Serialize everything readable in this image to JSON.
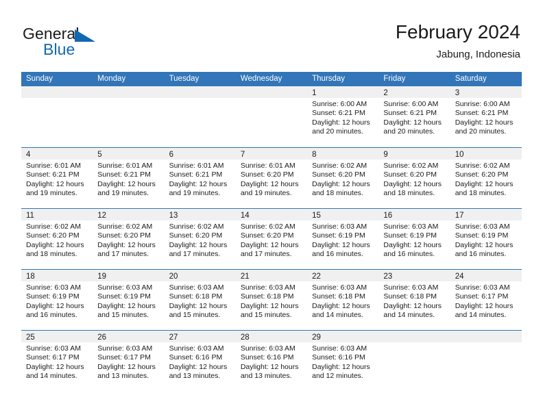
{
  "brand": {
    "name_top": "General",
    "name_bottom": "Blue",
    "accent_color": "#1268b3",
    "triangle_icon": "brand-triangle-icon"
  },
  "header": {
    "title": "February 2024",
    "subtitle": "Jabung, Indonesia"
  },
  "colors": {
    "header_blue": "#3275b8",
    "day_band_gray": "#f0f0f0",
    "text": "#1a1a1a"
  },
  "weekdays": [
    "Sunday",
    "Monday",
    "Tuesday",
    "Wednesday",
    "Thursday",
    "Friday",
    "Saturday"
  ],
  "weeks": [
    [
      {
        "day": "",
        "sunrise": "",
        "sunset": "",
        "daylight": ""
      },
      {
        "day": "",
        "sunrise": "",
        "sunset": "",
        "daylight": ""
      },
      {
        "day": "",
        "sunrise": "",
        "sunset": "",
        "daylight": ""
      },
      {
        "day": "",
        "sunrise": "",
        "sunset": "",
        "daylight": ""
      },
      {
        "day": "1",
        "sunrise": "Sunrise: 6:00 AM",
        "sunset": "Sunset: 6:21 PM",
        "daylight": "Daylight: 12 hours and 20 minutes."
      },
      {
        "day": "2",
        "sunrise": "Sunrise: 6:00 AM",
        "sunset": "Sunset: 6:21 PM",
        "daylight": "Daylight: 12 hours and 20 minutes."
      },
      {
        "day": "3",
        "sunrise": "Sunrise: 6:00 AM",
        "sunset": "Sunset: 6:21 PM",
        "daylight": "Daylight: 12 hours and 20 minutes."
      }
    ],
    [
      {
        "day": "4",
        "sunrise": "Sunrise: 6:01 AM",
        "sunset": "Sunset: 6:21 PM",
        "daylight": "Daylight: 12 hours and 19 minutes."
      },
      {
        "day": "5",
        "sunrise": "Sunrise: 6:01 AM",
        "sunset": "Sunset: 6:21 PM",
        "daylight": "Daylight: 12 hours and 19 minutes."
      },
      {
        "day": "6",
        "sunrise": "Sunrise: 6:01 AM",
        "sunset": "Sunset: 6:21 PM",
        "daylight": "Daylight: 12 hours and 19 minutes."
      },
      {
        "day": "7",
        "sunrise": "Sunrise: 6:01 AM",
        "sunset": "Sunset: 6:20 PM",
        "daylight": "Daylight: 12 hours and 19 minutes."
      },
      {
        "day": "8",
        "sunrise": "Sunrise: 6:02 AM",
        "sunset": "Sunset: 6:20 PM",
        "daylight": "Daylight: 12 hours and 18 minutes."
      },
      {
        "day": "9",
        "sunrise": "Sunrise: 6:02 AM",
        "sunset": "Sunset: 6:20 PM",
        "daylight": "Daylight: 12 hours and 18 minutes."
      },
      {
        "day": "10",
        "sunrise": "Sunrise: 6:02 AM",
        "sunset": "Sunset: 6:20 PM",
        "daylight": "Daylight: 12 hours and 18 minutes."
      }
    ],
    [
      {
        "day": "11",
        "sunrise": "Sunrise: 6:02 AM",
        "sunset": "Sunset: 6:20 PM",
        "daylight": "Daylight: 12 hours and 18 minutes."
      },
      {
        "day": "12",
        "sunrise": "Sunrise: 6:02 AM",
        "sunset": "Sunset: 6:20 PM",
        "daylight": "Daylight: 12 hours and 17 minutes."
      },
      {
        "day": "13",
        "sunrise": "Sunrise: 6:02 AM",
        "sunset": "Sunset: 6:20 PM",
        "daylight": "Daylight: 12 hours and 17 minutes."
      },
      {
        "day": "14",
        "sunrise": "Sunrise: 6:02 AM",
        "sunset": "Sunset: 6:20 PM",
        "daylight": "Daylight: 12 hours and 17 minutes."
      },
      {
        "day": "15",
        "sunrise": "Sunrise: 6:03 AM",
        "sunset": "Sunset: 6:19 PM",
        "daylight": "Daylight: 12 hours and 16 minutes."
      },
      {
        "day": "16",
        "sunrise": "Sunrise: 6:03 AM",
        "sunset": "Sunset: 6:19 PM",
        "daylight": "Daylight: 12 hours and 16 minutes."
      },
      {
        "day": "17",
        "sunrise": "Sunrise: 6:03 AM",
        "sunset": "Sunset: 6:19 PM",
        "daylight": "Daylight: 12 hours and 16 minutes."
      }
    ],
    [
      {
        "day": "18",
        "sunrise": "Sunrise: 6:03 AM",
        "sunset": "Sunset: 6:19 PM",
        "daylight": "Daylight: 12 hours and 16 minutes."
      },
      {
        "day": "19",
        "sunrise": "Sunrise: 6:03 AM",
        "sunset": "Sunset: 6:19 PM",
        "daylight": "Daylight: 12 hours and 15 minutes."
      },
      {
        "day": "20",
        "sunrise": "Sunrise: 6:03 AM",
        "sunset": "Sunset: 6:18 PM",
        "daylight": "Daylight: 12 hours and 15 minutes."
      },
      {
        "day": "21",
        "sunrise": "Sunrise: 6:03 AM",
        "sunset": "Sunset: 6:18 PM",
        "daylight": "Daylight: 12 hours and 15 minutes."
      },
      {
        "day": "22",
        "sunrise": "Sunrise: 6:03 AM",
        "sunset": "Sunset: 6:18 PM",
        "daylight": "Daylight: 12 hours and 14 minutes."
      },
      {
        "day": "23",
        "sunrise": "Sunrise: 6:03 AM",
        "sunset": "Sunset: 6:18 PM",
        "daylight": "Daylight: 12 hours and 14 minutes."
      },
      {
        "day": "24",
        "sunrise": "Sunrise: 6:03 AM",
        "sunset": "Sunset: 6:17 PM",
        "daylight": "Daylight: 12 hours and 14 minutes."
      }
    ],
    [
      {
        "day": "25",
        "sunrise": "Sunrise: 6:03 AM",
        "sunset": "Sunset: 6:17 PM",
        "daylight": "Daylight: 12 hours and 14 minutes."
      },
      {
        "day": "26",
        "sunrise": "Sunrise: 6:03 AM",
        "sunset": "Sunset: 6:17 PM",
        "daylight": "Daylight: 12 hours and 13 minutes."
      },
      {
        "day": "27",
        "sunrise": "Sunrise: 6:03 AM",
        "sunset": "Sunset: 6:16 PM",
        "daylight": "Daylight: 12 hours and 13 minutes."
      },
      {
        "day": "28",
        "sunrise": "Sunrise: 6:03 AM",
        "sunset": "Sunset: 6:16 PM",
        "daylight": "Daylight: 12 hours and 13 minutes."
      },
      {
        "day": "29",
        "sunrise": "Sunrise: 6:03 AM",
        "sunset": "Sunset: 6:16 PM",
        "daylight": "Daylight: 12 hours and 12 minutes."
      },
      {
        "day": "",
        "sunrise": "",
        "sunset": "",
        "daylight": ""
      },
      {
        "day": "",
        "sunrise": "",
        "sunset": "",
        "daylight": ""
      }
    ]
  ]
}
